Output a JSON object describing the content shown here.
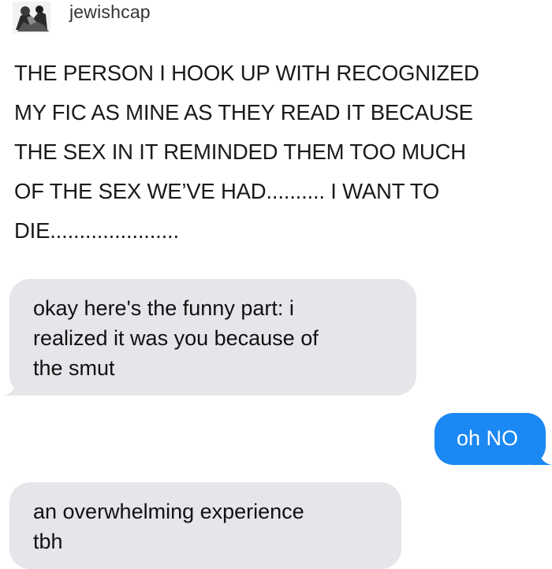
{
  "post": {
    "username": "jewishcap",
    "avatar_icon": "avatar-photo-icon",
    "text_lines": [
      "THE PERSON I HOOK UP WITH RECOGNIZED",
      "MY FIC AS MINE AS THEY READ IT BECAUSE",
      "THE SEX IN IT REMINDED THEM TOO MUCH",
      "OF THE SEX WE’VE HAD.......... I WANT TO",
      "DIE......................"
    ]
  },
  "messages": [
    {
      "direction": "incoming",
      "lines": [
        "okay here's the funny part: i",
        "realized it was you because of",
        "the smut"
      ]
    },
    {
      "direction": "outgoing",
      "lines": [
        "oh NO"
      ]
    },
    {
      "direction": "incoming",
      "lines": [
        "an overwhelming experience",
        "tbh"
      ]
    }
  ],
  "colors": {
    "incoming_bubble": "#e5e5ea",
    "outgoing_bubble": "#1b88f3",
    "outgoing_text": "#ffffff",
    "background": "#ffffff"
  }
}
